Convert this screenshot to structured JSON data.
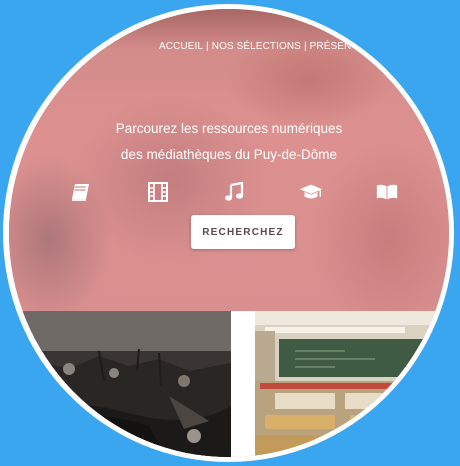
{
  "nav": {
    "items": [
      "ACCUEIL",
      "NOS SÉLECTIONS",
      "PRÉSENTATION"
    ],
    "separator": "|"
  },
  "hero": {
    "line1": "Parcourez les ressources numériques",
    "line2": "des médiathèques du Puy-de-Dôme",
    "button_label": "RECHERCHEZ",
    "icons": [
      "book-icon",
      "film-icon",
      "music-icon",
      "graduation-cap-icon",
      "open-book-icon"
    ]
  },
  "colors": {
    "background": "#3aa6f0",
    "hero_overlay": "#d88f8e",
    "text": "#ffffff",
    "button_text": "#5a4a4d"
  }
}
